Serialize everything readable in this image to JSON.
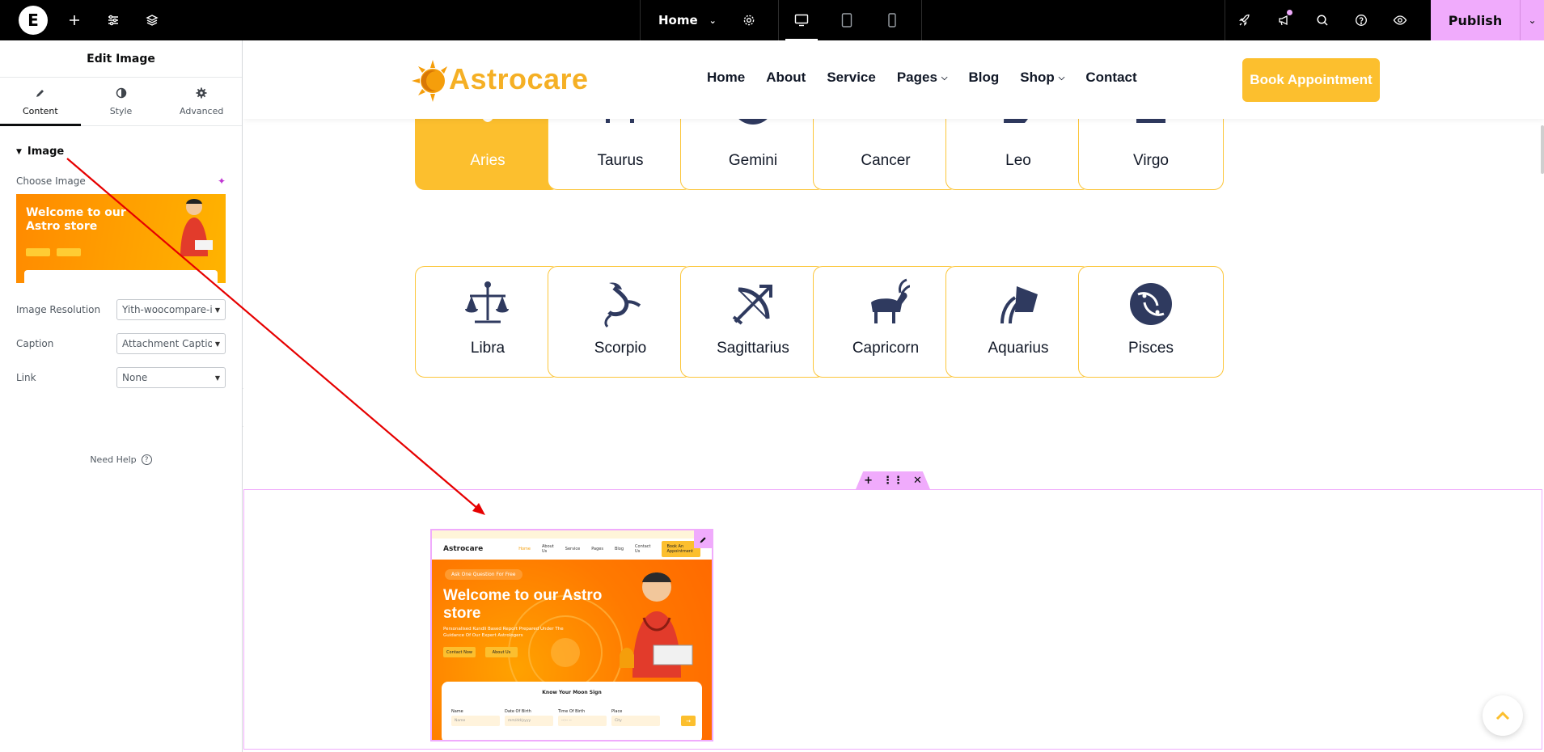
{
  "topbar": {
    "logo_letter": "E",
    "page_name": "Home",
    "publish_label": "Publish",
    "icons": [
      "elementor-logo-icon",
      "plus-icon",
      "sliders-icon",
      "layers-icon",
      "gear-icon",
      "desktop-icon",
      "tablet-icon",
      "mobile-icon",
      "rocket-icon",
      "megaphone-icon",
      "search-icon",
      "help-icon",
      "eye-icon",
      "chevron-down-icon"
    ]
  },
  "panel": {
    "title": "Edit Image",
    "tabs": [
      {
        "label": "Content",
        "icon": "pencil-icon",
        "active": true
      },
      {
        "label": "Style",
        "icon": "half-circle-icon",
        "active": false
      },
      {
        "label": "Advanced",
        "icon": "gear-icon",
        "active": false
      }
    ],
    "section_title": "Image",
    "choose_image_label": "Choose Image",
    "thumb_title": "Welcome to our Astro store",
    "controls": [
      {
        "label": "Image Resolution",
        "value": "Yith-woocompare-image"
      },
      {
        "label": "Caption",
        "value": "Attachment Caption"
      },
      {
        "label": "Link",
        "value": "None"
      }
    ],
    "need_help": "Need Help",
    "help_mark": "?"
  },
  "site": {
    "logo_text": "Astrocare",
    "nav": [
      {
        "label": "Home",
        "dropdown": false
      },
      {
        "label": "About",
        "dropdown": false
      },
      {
        "label": "Service",
        "dropdown": false
      },
      {
        "label": "Pages",
        "dropdown": true
      },
      {
        "label": "Blog",
        "dropdown": false
      },
      {
        "label": "Shop",
        "dropdown": true
      },
      {
        "label": "Contact",
        "dropdown": false
      }
    ],
    "book_button": "Book Appointment",
    "zodiac": [
      {
        "name": "Aries",
        "active": true
      },
      {
        "name": "Taurus",
        "active": false
      },
      {
        "name": "Gemini",
        "active": false
      },
      {
        "name": "Cancer",
        "active": false
      },
      {
        "name": "Leo",
        "active": false
      },
      {
        "name": "Virgo",
        "active": false
      },
      {
        "name": "Libra",
        "active": false
      },
      {
        "name": "Scorpio",
        "active": false
      },
      {
        "name": "Sagittarius",
        "active": false
      },
      {
        "name": "Capricorn",
        "active": false
      },
      {
        "name": "Aquarius",
        "active": false
      },
      {
        "name": "Pisces",
        "active": false
      }
    ]
  },
  "preview": {
    "nav_logo": "Astrocare",
    "nav_links": [
      "Home",
      "About Us",
      "Service",
      "Pages",
      "Blog",
      "Contact Us"
    ],
    "nav_button": "Book An Appointment",
    "ask": "Ask One Question For Free",
    "title": "Welcome to our Astro store",
    "subtitle": "Personalised Kundli Based Report Prepared Under The Guidance Of Our Expert Astrologers",
    "btn_contact": "Contact Now",
    "btn_about": "About Us",
    "card_title": "Know Your Moon Sign",
    "fields": [
      {
        "label": "Name",
        "placeholder": "Name"
      },
      {
        "label": "Date Of Birth",
        "placeholder": "mm/dd/yyyy"
      },
      {
        "label": "Time Of Birth",
        "placeholder": "--:-- --"
      },
      {
        "label": "Place",
        "placeholder": "City"
      }
    ]
  },
  "colors": {
    "accent": "#fcbf2e",
    "editor_pink": "#f0abfc",
    "navy": "#2f3a5f",
    "annotation": "#e60000"
  }
}
